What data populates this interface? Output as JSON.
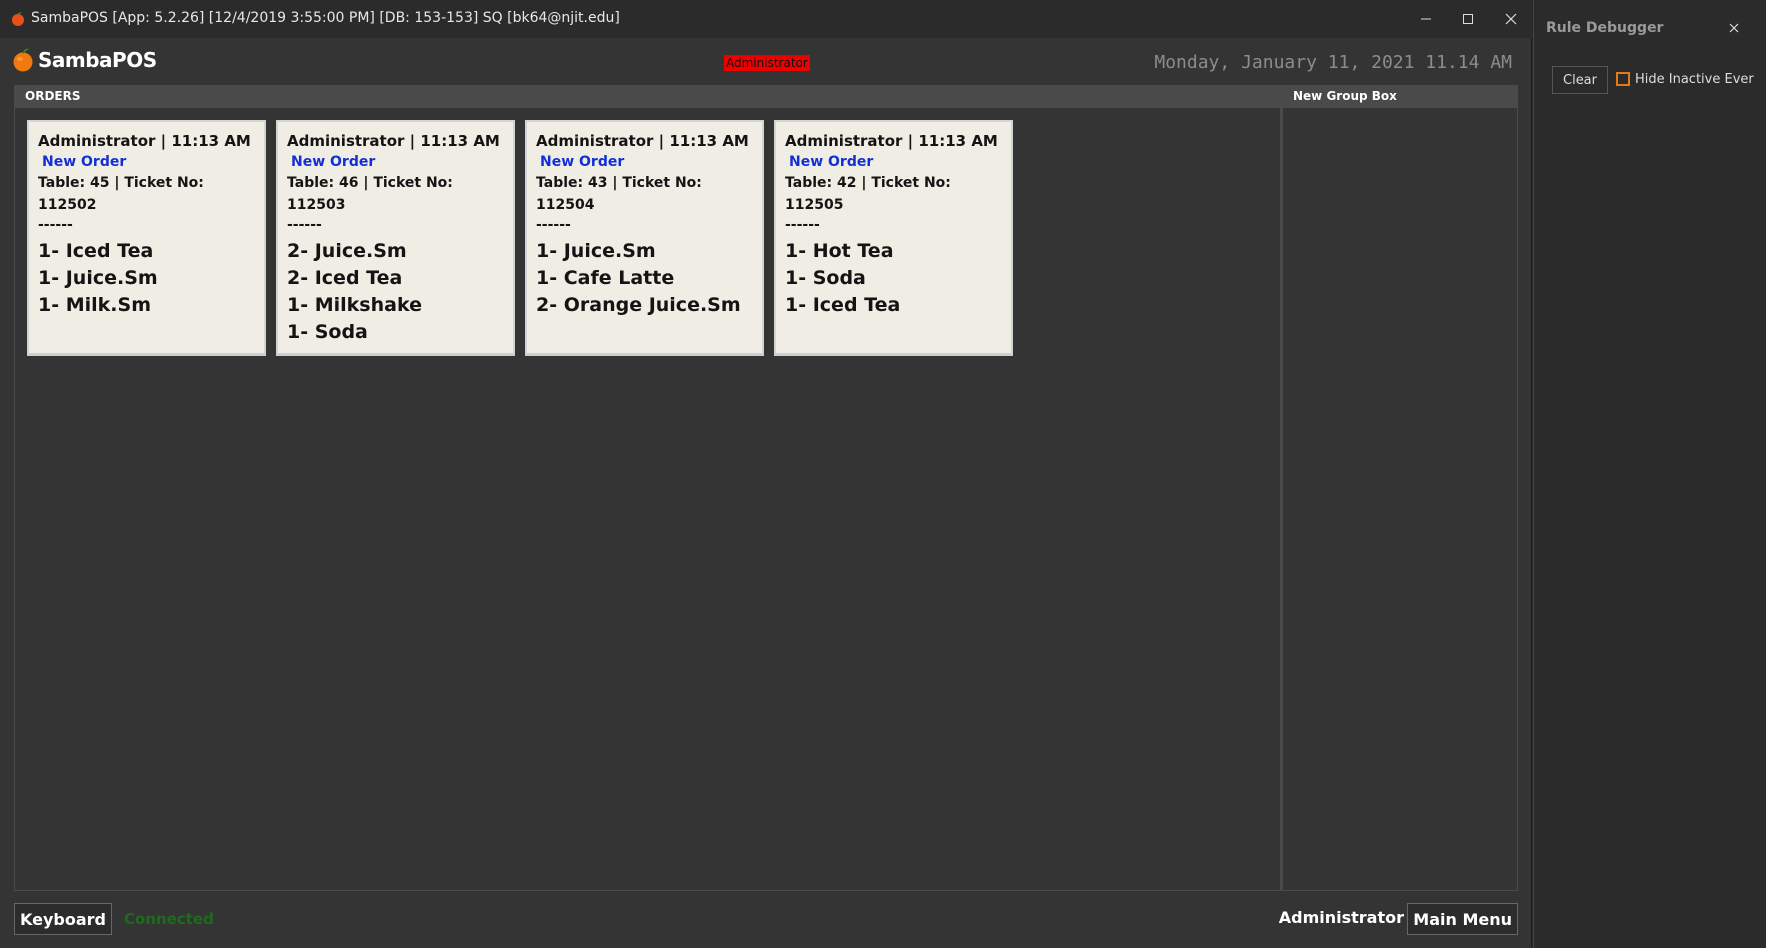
{
  "window": {
    "title": "SambaPOS [App: 5.2.26] [12/4/2019 3:55:00 PM] [DB: 153-153] SQ [bk64@njit.edu]",
    "icon": "sambapos-app-icon"
  },
  "header": {
    "logo_text": "SambaPOS",
    "logged_user_badge": "Administrator",
    "badge_color": "#ee0000",
    "datetime": "Monday, January 11, 2021 11.14 AM"
  },
  "orders_panel": {
    "title": "ORDERS",
    "tickets": [
      {
        "header": "Administrator | 11:13 AM",
        "status": "New Order",
        "table_line": "Table: 45 | Ticket No:",
        "ticket_no": "112502",
        "separator": "------",
        "items": [
          "1- Iced Tea",
          "1- Juice.Sm",
          "1- Milk.Sm"
        ]
      },
      {
        "header": "Administrator | 11:13 AM",
        "status": "New Order",
        "table_line": "Table: 46 | Ticket No:",
        "ticket_no": "112503",
        "separator": "------",
        "items": [
          "2- Juice.Sm",
          "2- Iced Tea",
          "1- Milkshake",
          "1- Soda"
        ]
      },
      {
        "header": "Administrator | 11:13 AM",
        "status": "New Order",
        "table_line": "Table: 43 | Ticket No:",
        "ticket_no": "112504",
        "separator": "------",
        "items": [
          "1- Juice.Sm",
          "1- Cafe Latte",
          "2- Orange Juice.Sm"
        ]
      },
      {
        "header": "Administrator | 11:13 AM",
        "status": "New Order",
        "table_line": "Table: 42 | Ticket No:",
        "ticket_no": "112505",
        "separator": "------",
        "items": [
          "1- Hot Tea",
          "1- Soda",
          "1- Iced Tea"
        ]
      }
    ]
  },
  "group_panel": {
    "title": "New Group Box"
  },
  "footer": {
    "keyboard_label": "Keyboard",
    "connection_status": "Connected",
    "connection_color": "#1d6b1d",
    "user": "Administrator",
    "main_menu_label": "Main Menu"
  },
  "debugger": {
    "title": "Rule Debugger",
    "clear_label": "Clear",
    "hide_inactive_label": "Hide Inactive Ever",
    "hide_inactive_checked": false
  },
  "colors": {
    "status_blue": "#1330d6",
    "card_bg": "#efede4",
    "checkbox_orange": "#e07b1a"
  }
}
